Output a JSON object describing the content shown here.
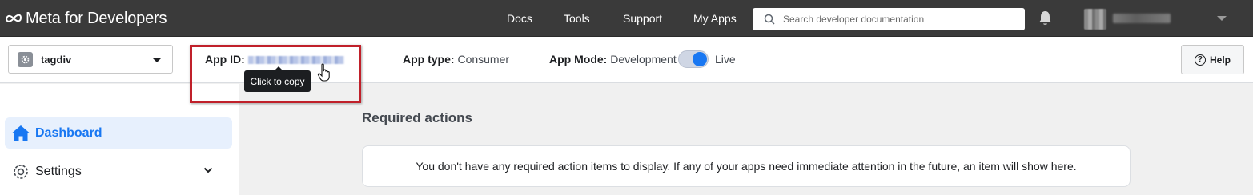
{
  "brand": {
    "name": "Meta for Developers"
  },
  "nav": {
    "docs": "Docs",
    "tools": "Tools",
    "support": "Support",
    "my_apps": "My Apps"
  },
  "search": {
    "placeholder": "Search developer documentation",
    "icon": "search-icon"
  },
  "appbar": {
    "app_name": "tagdiv",
    "app_id_label": "App ID:",
    "app_type_label": "App type:",
    "app_type_value": "Consumer",
    "app_mode_label": "App Mode:",
    "app_mode_value": "Development",
    "live_label": "Live",
    "help_label": "Help"
  },
  "tooltip": {
    "text": "Click to copy"
  },
  "sidebar": {
    "items": [
      {
        "label": "Dashboard",
        "icon": "home-icon",
        "active": true
      },
      {
        "label": "Settings",
        "icon": "gear-icon",
        "active": false
      }
    ]
  },
  "main": {
    "section_title": "Required actions",
    "empty_message": "You don't have any required action items to display. If any of your apps need immediate attention in the future, an item will show here."
  },
  "colors": {
    "accent": "#1877f2",
    "topbar": "#3a3a3a",
    "highlight": "#c0202a"
  }
}
